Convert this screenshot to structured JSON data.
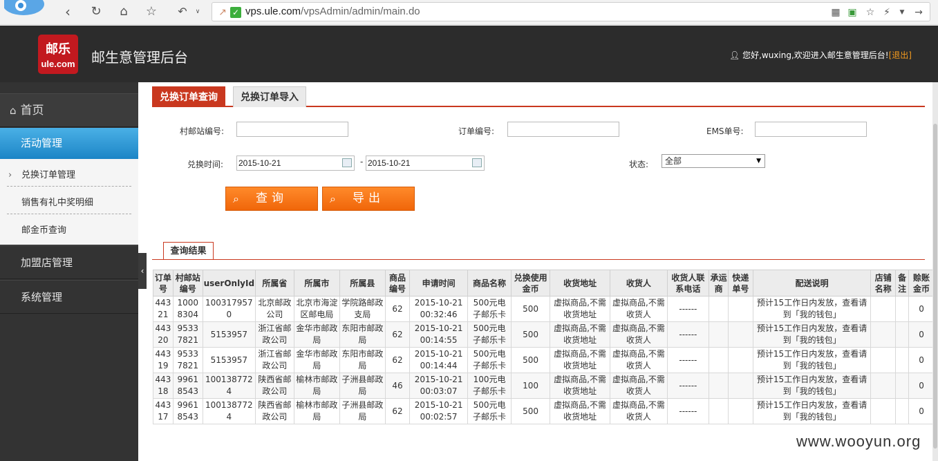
{
  "browser": {
    "url_host": "vps.ule.com",
    "url_path": "/vpsAdmin/admin/main.do"
  },
  "header": {
    "logo_line1": "邮乐",
    "logo_line2": "ule.com",
    "title": "邮生意管理后台",
    "welcome": "您好,wuxing,欢迎进入邮生意管理后台!",
    "logout": "[退出]"
  },
  "sidebar": {
    "home": "首页",
    "active_section": "活动管理",
    "sub_items": [
      "兑换订单管理",
      "销售有礼中奖明细",
      "邮金币查询"
    ],
    "sections": [
      "加盟店管理",
      "系统管理"
    ]
  },
  "tabs": [
    "兑换订单查询",
    "兑换订单导入"
  ],
  "form": {
    "station_label": "村邮站编号:",
    "order_label": "订单编号:",
    "ems_label": "EMS单号:",
    "time_label": "兑换时间:",
    "date_from": "2015-10-21",
    "date_sep": "-",
    "date_to": "2015-10-21",
    "status_label": "状态:",
    "status_value": "全部",
    "query_button": "查询",
    "export_button": "导出"
  },
  "results": {
    "tab_label": "查询结果",
    "headers": [
      "订单号",
      "村邮站编号",
      "userOnlyId",
      "所属省",
      "所属市",
      "所属县",
      "商品编号",
      "申请时间",
      "商品名称",
      "兑换使用金币",
      "收货地址",
      "收货人",
      "收货人联系电话",
      "承运商",
      "快递单号",
      "配送说明",
      "店铺名称",
      "备注",
      "赊账金币"
    ],
    "rows": [
      [
        "44321",
        "10008304",
        "1003179570",
        "北京邮政公司",
        "北京市海淀区邮电局",
        "学院路邮政支局",
        "62",
        "2015-10-21 00:32:46",
        "500元电子邮乐卡",
        "500",
        "虚拟商品,不需收货地址",
        "虚拟商品,不需收货人",
        "------",
        "",
        "",
        "预计15工作日内发放，查看请到「我的钱包」",
        "",
        "",
        "0"
      ],
      [
        "44320",
        "95337821",
        "5153957",
        "浙江省邮政公司",
        "金华市邮政局",
        "东阳市邮政局",
        "62",
        "2015-10-21 00:14:55",
        "500元电子邮乐卡",
        "500",
        "虚拟商品,不需收货地址",
        "虚拟商品,不需收货人",
        "------",
        "",
        "",
        "预计15工作日内发放，查看请到「我的钱包」",
        "",
        "",
        "0"
      ],
      [
        "44319",
        "95337821",
        "5153957",
        "浙江省邮政公司",
        "金华市邮政局",
        "东阳市邮政局",
        "62",
        "2015-10-21 00:14:44",
        "500元电子邮乐卡",
        "500",
        "虚拟商品,不需收货地址",
        "虚拟商品,不需收货人",
        "------",
        "",
        "",
        "预计15工作日内发放，查看请到「我的钱包」",
        "",
        "",
        "0"
      ],
      [
        "44318",
        "99618543",
        "1001387724",
        "陕西省邮政公司",
        "榆林市邮政局",
        "子洲县邮政局",
        "46",
        "2015-10-21 00:03:07",
        "100元电子邮乐卡",
        "100",
        "虚拟商品,不需收货地址",
        "虚拟商品,不需收货人",
        "------",
        "",
        "",
        "预计15工作日内发放，查看请到「我的钱包」",
        "",
        "",
        "0"
      ],
      [
        "44317",
        "99618543",
        "1001387724",
        "陕西省邮政公司",
        "榆林市邮政局",
        "子洲县邮政局",
        "62",
        "2015-10-21 00:02:57",
        "500元电子邮乐卡",
        "500",
        "虚拟商品,不需收货地址",
        "虚拟商品,不需收货人",
        "------",
        "",
        "",
        "预计15工作日内发放，查看请到「我的钱包」",
        "",
        "",
        "0"
      ]
    ]
  },
  "watermark": "www.wooyun.org"
}
